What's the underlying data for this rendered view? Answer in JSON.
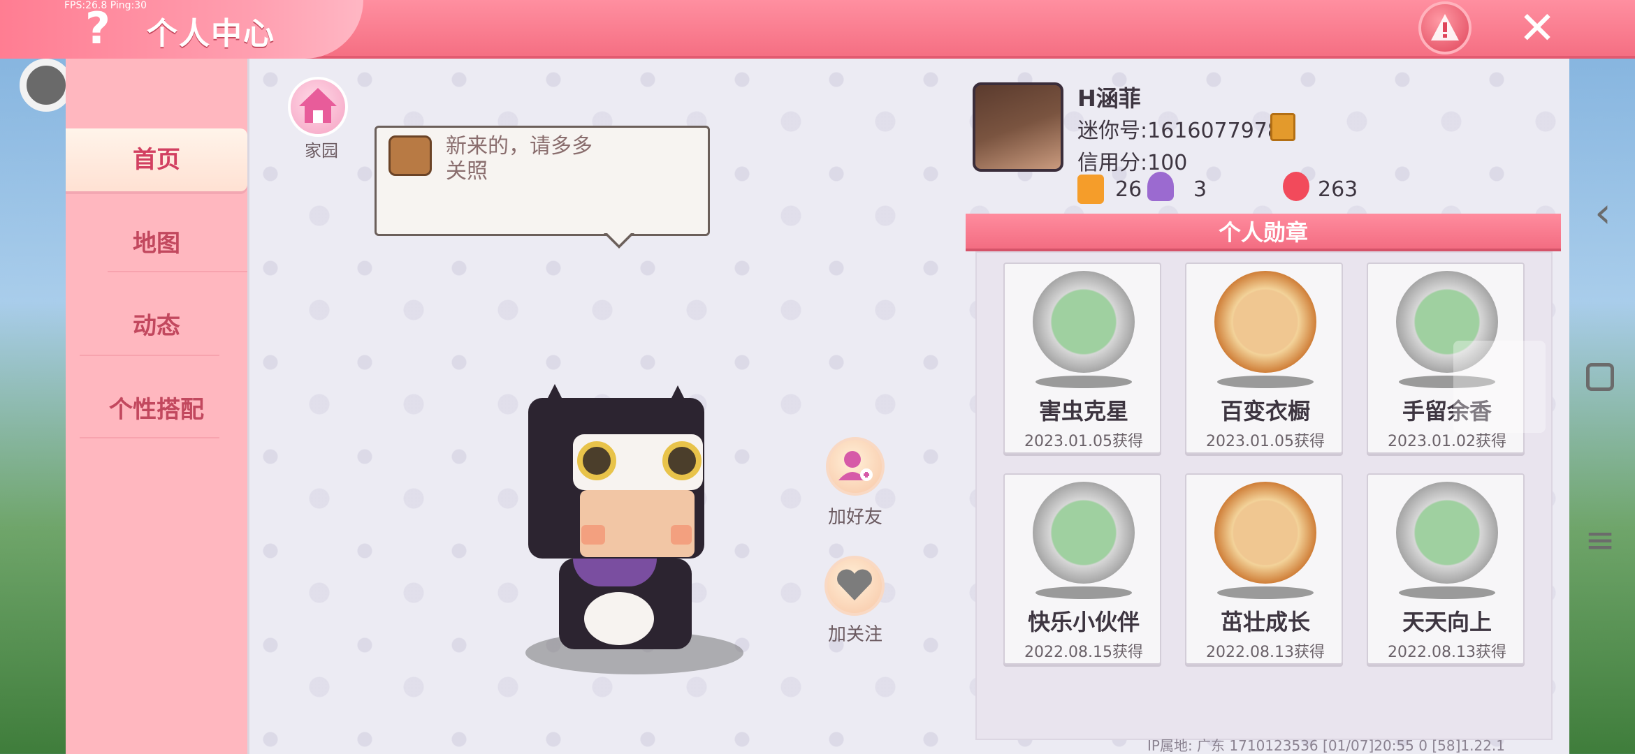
{
  "header": {
    "fps_ping": "FPS:26.8  Ping:30",
    "title": "个人中心"
  },
  "sidebar": {
    "items": [
      {
        "label": "首页"
      },
      {
        "label": "地图"
      },
      {
        "label": "动态"
      },
      {
        "label": "个性搭配"
      }
    ]
  },
  "home": {
    "label": "家园"
  },
  "bubble": {
    "text_line1": "新来的，请多多",
    "text_line2": "关照"
  },
  "actions": {
    "add_friend": "加好友",
    "follow": "加关注"
  },
  "profile": {
    "name": "H涵菲",
    "mini_id": "迷你号:1616077978",
    "credit": "信用分:100",
    "stats": [
      {
        "icon": "plus-bookmark-icon",
        "value": "26"
      },
      {
        "icon": "trophy-icon",
        "value": "3"
      },
      {
        "icon": "flame-icon",
        "value": "263"
      }
    ]
  },
  "badges": {
    "title": "个人勋章",
    "items": [
      {
        "name": "害虫克星",
        "date": "2023.01.05获得",
        "tier": "silver"
      },
      {
        "name": "百变衣橱",
        "date": "2023.01.05获得",
        "tier": "gold"
      },
      {
        "name": "手留余香",
        "date": "2023.01.02获得",
        "tier": "silver"
      },
      {
        "name": "快乐小伙伴",
        "date": "2022.08.15获得",
        "tier": "silver"
      },
      {
        "name": "茁壮成长",
        "date": "2022.08.13获得",
        "tier": "gold"
      },
      {
        "name": "天天向上",
        "date": "2022.08.13获得",
        "tier": "silver"
      }
    ]
  },
  "footer": {
    "info": "IP属地: 广东      1710123536    [01/07]20:55 0  [58]1.22.1"
  },
  "colors": {
    "accent": "#f56f83",
    "sidebar": "#ffb7bf",
    "panel": "#ecebf3"
  }
}
